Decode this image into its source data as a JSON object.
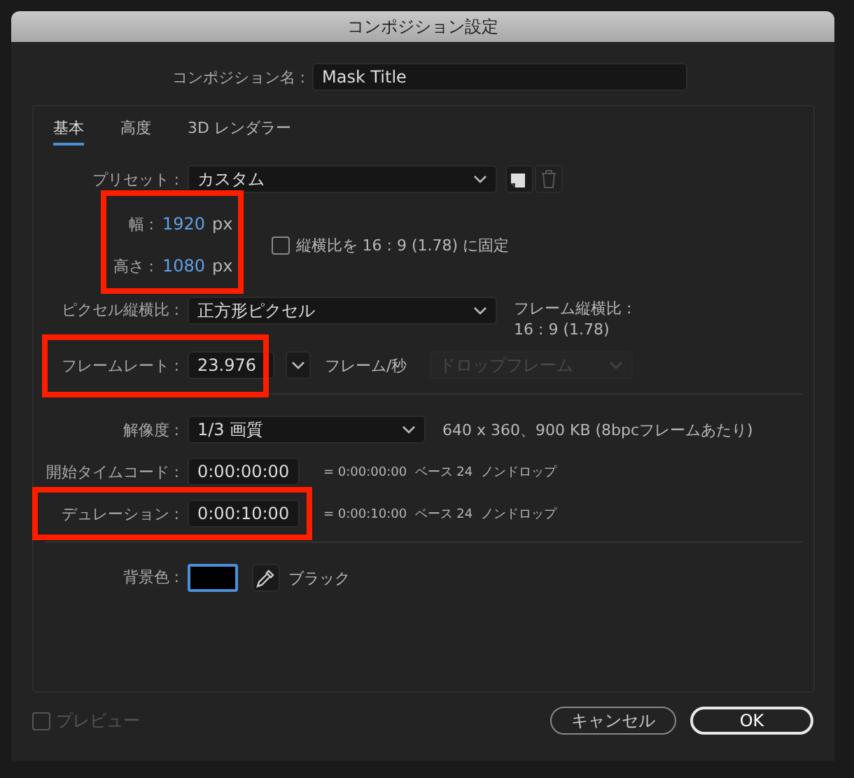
{
  "window": {
    "title": "コンポジション設定"
  },
  "comp_name": {
    "label": "コンポジション名 :",
    "value": "Mask Title"
  },
  "tabs": [
    {
      "label": "基本",
      "selected": true
    },
    {
      "label": "高度",
      "selected": false
    },
    {
      "label": "3D レンダラー",
      "selected": false
    }
  ],
  "preset": {
    "label": "プリセット :",
    "value": "カスタム"
  },
  "size": {
    "highlighted": true,
    "fields": [
      {
        "label": "幅 :",
        "value": "1920",
        "unit": "px"
      },
      {
        "label": "高さ :",
        "value": "1080",
        "unit": "px"
      }
    ]
  },
  "lock_aspect": {
    "label": "縦横比を 16 : 9 (1.78) に固定",
    "checked": false
  },
  "pixel_aspect": {
    "label": "ピクセル縦横比 :",
    "value": "正方形ピクセル",
    "frame_aspect_label": "フレーム縦横比 :",
    "frame_aspect_value": "16 : 9 (1.78)"
  },
  "frame_rate": {
    "label": "フレームレート :",
    "value": "23.976",
    "unit": "フレーム/秒",
    "highlighted": true,
    "drop_frame": {
      "value": "ドロップフレーム",
      "disabled": true
    }
  },
  "resolution": {
    "label": "解像度 :",
    "value": "1/3 画質",
    "info": "640 x 360、900 KB (8bpcフレームあたり)"
  },
  "timecodes": [
    {
      "label": "開始タイムコード :",
      "value": "0:00:00:00",
      "info": "= 0:00:00:00  ベース 24  ノンドロップ",
      "highlighted": false
    },
    {
      "label": "デュレーション :",
      "value": "0:00:10:00",
      "info": "= 0:00:10:00  ベース 24  ノンドロップ",
      "highlighted": true
    }
  ],
  "background_color": {
    "label": "背景色 :",
    "color": "#000000",
    "name": "ブラック"
  },
  "preview": {
    "label": "プレビュー",
    "checked": false,
    "disabled": true
  },
  "buttons": [
    {
      "label": "キャンセル",
      "kind": "cancel"
    },
    {
      "label": "OK",
      "kind": "default"
    }
  ]
}
